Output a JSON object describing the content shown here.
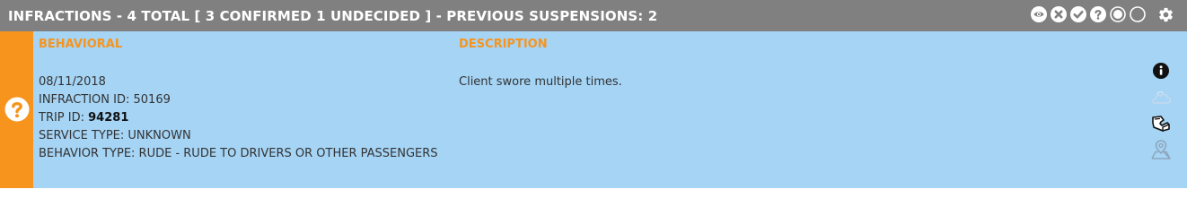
{
  "header": {
    "title": "INFRACTIONS - 4 TOTAL [ 3 CONFIRMED 1 UNDECIDED ] - PREVIOUS SUSPENSIONS: 2",
    "background": "#808080",
    "icons": [
      "eye-icon",
      "x-circle-icon",
      "check-circle-icon",
      "question-circle-icon",
      "radio-selected-icon",
      "radio-empty-icon",
      "gear-icon"
    ]
  },
  "infraction": {
    "status_color": "#f7941d",
    "status_icon": "question-circle-icon",
    "row_background": "#a5d4f5",
    "category_label": "BEHAVIORAL",
    "description_label": "DESCRIPTION",
    "date": "08/11/2018",
    "infraction_id_label": "INFRACTION ID: ",
    "infraction_id": "50169",
    "trip_id_label": "TRIP ID: ",
    "trip_id": "94281",
    "service_type_label": "SERVICE TYPE: ",
    "service_type": "UNKNOWN",
    "behavior_type_label": "BEHAVIOR TYPE: ",
    "behavior_type": "RUDE - RUDE TO DRIVERS OR OTHER PASSENGERS",
    "description": "Client swore multiple times.",
    "side_icons": [
      "info-icon",
      "weather-cloud-icon",
      "vehicle-icon",
      "map-pin-icon"
    ]
  }
}
